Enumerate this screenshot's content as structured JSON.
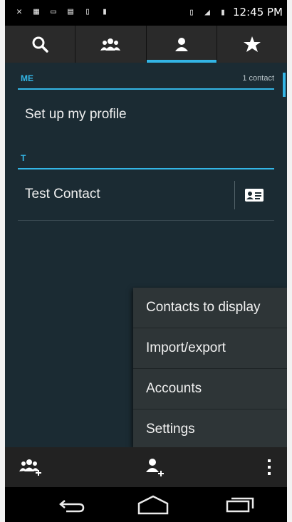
{
  "status_bar": {
    "time": "12:45 PM",
    "icons": [
      "signal-off-icon",
      "qr-icon",
      "image-icon",
      "message-icon",
      "battery-icon",
      "sd-card-icon"
    ]
  },
  "tabs": [
    {
      "icon": "search-icon",
      "active": false
    },
    {
      "icon": "groups-icon",
      "active": false
    },
    {
      "icon": "person-icon",
      "active": true
    },
    {
      "icon": "star-icon",
      "active": false
    }
  ],
  "sections": {
    "me": {
      "letter": "ME",
      "count": "1 contact",
      "row": "Set up my profile"
    },
    "t": {
      "letter": "T",
      "row": "Test Contact"
    }
  },
  "menu": {
    "items": [
      "Contacts to display",
      "Import/export",
      "Accounts",
      "Settings"
    ]
  },
  "colors": {
    "accent": "#33b5e5",
    "background": "#1b2b33",
    "menu": "#2e3537"
  }
}
